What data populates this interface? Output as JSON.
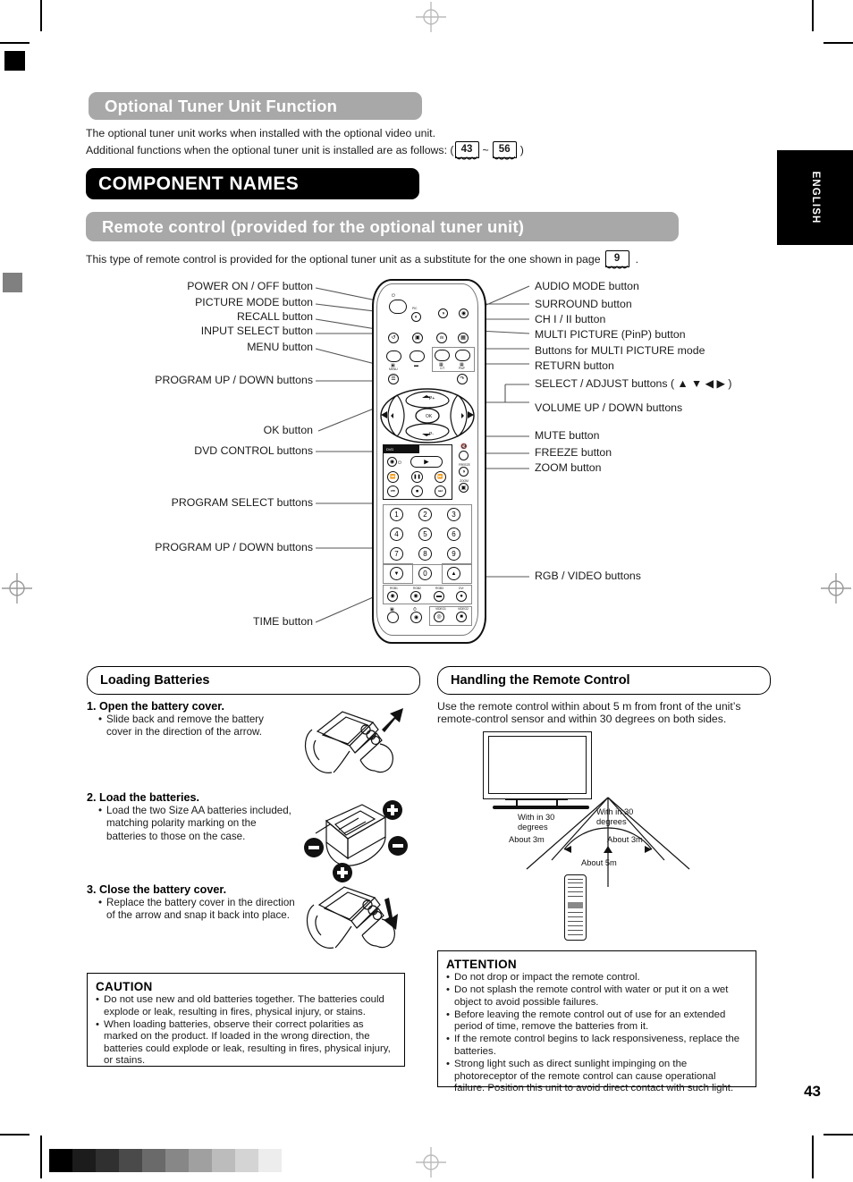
{
  "page": {
    "number": "43",
    "language_tab": "ENGLISH"
  },
  "headings": {
    "optional_tuner": "Optional Tuner Unit Function",
    "component_names": "COMPONENT NAMES",
    "remote_control": "Remote control (provided for the optional tuner unit)"
  },
  "intro": {
    "line1": "The optional tuner unit works when installed with the optional video unit.",
    "line2_pre": "Additional functions when the optional tuner unit is installed are as follows: (",
    "page_ref_from": "43",
    "tilde": "~",
    "page_ref_to": "56",
    "line2_post": ")",
    "remote_note_pre": "This type of remote control is provided for the optional tuner unit as a substitute for the one shown in page",
    "remote_note_page": "9",
    "remote_note_post": "."
  },
  "callouts_left": [
    {
      "text": "POWER ON / OFF button"
    },
    {
      "text": "PICTURE MODE button"
    },
    {
      "text": "RECALL button"
    },
    {
      "text": "INPUT SELECT button"
    },
    {
      "text": "MENU button"
    },
    {
      "text": "PROGRAM UP / DOWN buttons"
    },
    {
      "text": "OK button"
    },
    {
      "text": "DVD CONTROL buttons"
    },
    {
      "text": "PROGRAM SELECT buttons"
    },
    {
      "text": "PROGRAM UP / DOWN buttons"
    },
    {
      "text": "TIME button"
    }
  ],
  "callouts_right": [
    {
      "text": "AUDIO MODE button"
    },
    {
      "text": "SURROUND button"
    },
    {
      "text": "CH I / II button"
    },
    {
      "text": "MULTI PICTURE (PinP) button"
    },
    {
      "text": "Buttons for MULTI PICTURE mode"
    },
    {
      "text": "RETURN button"
    },
    {
      "text": "SELECT / ADJUST buttons ( ▲ ▼ ◀ ▶ )"
    },
    {
      "text": "VOLUME UP / DOWN buttons"
    },
    {
      "text": "MUTE button"
    },
    {
      "text": "FREEZE button"
    },
    {
      "text": "ZOOM button"
    },
    {
      "text": "RGB / VIDEO buttons"
    }
  ],
  "remote_face": {
    "micro_labels": [
      "MENU",
      "",
      "C/T",
      "PinP",
      "P+",
      "P-",
      "VOL",
      "VOL"
    ],
    "keypad": [
      "1",
      "2",
      "3",
      "4",
      "5",
      "6",
      "7",
      "8",
      "9",
      "0"
    ],
    "source_row1": [
      "RGB1",
      "RGB2",
      "RGB3",
      "DVI"
    ],
    "source_row2": [
      "VIDEO1",
      "VIDEO2"
    ],
    "dvd_label": "DVD",
    "mute_label": "MUTE",
    "freeze_label": "FREEZE",
    "zoom_label": "ZOOM"
  },
  "loading_batteries": {
    "title": "Loading Batteries",
    "steps": [
      {
        "head": "1. Open the battery cover.",
        "body": "Slide back and remove the battery cover in the direction of the arrow."
      },
      {
        "head": "2. Load the batteries.",
        "body": "Load the two Size AA batteries included, matching polarity marking on the batteries to those on the case."
      },
      {
        "head": "3. Close the battery cover.",
        "body": "Replace the battery cover in the direction of the arrow and snap it back into place."
      }
    ],
    "caution": {
      "title": "CAUTION",
      "items": [
        "Do not use new and old batteries together.  The batteries could explode or leak, resulting in fires, physical injury, or stains.",
        "When loading batteries, observe their correct polarities as marked on the product. If loaded in the wrong direction, the batteries could explode or leak, resulting in fires, physical injury, or stains."
      ]
    }
  },
  "handling": {
    "title": "Handling the Remote Control",
    "intro_line1": "Use the remote control within about 5 m from front of the unit’s",
    "intro_line2": "remote-control sensor and within 30 degrees on both sides.",
    "diagram": {
      "left_angle_line1": "With in 30",
      "left_angle_line2": "degrees",
      "right_angle_line1": "With in 30",
      "right_angle_line2": "degrees",
      "left_distance": "About 3m",
      "right_distance": "About 3m",
      "center_distance": "About 5m"
    },
    "attention": {
      "title": "ATTENTION",
      "items": [
        "Do not drop or impact the remote control.",
        "Do not splash the remote control with water or put it on a wet object to avoid possible failures.",
        "Before leaving the remote control out of use for an extended period of time, remove the batteries from it.",
        "If the remote control begins to lack responsiveness, replace the batteries.",
        "Strong light such as direct sunlight impinging on the photoreceptor of the remote control can cause operational failure. Position this unit to avoid direct contact with such light."
      ]
    }
  },
  "grayscale_strip": [
    "#000000",
    "#1c1c1c",
    "#303030",
    "#4a4a4a",
    "#6a6a6a",
    "#878787",
    "#a0a0a0",
    "#bcbcbc",
    "#d4d4d4",
    "#ededed"
  ]
}
